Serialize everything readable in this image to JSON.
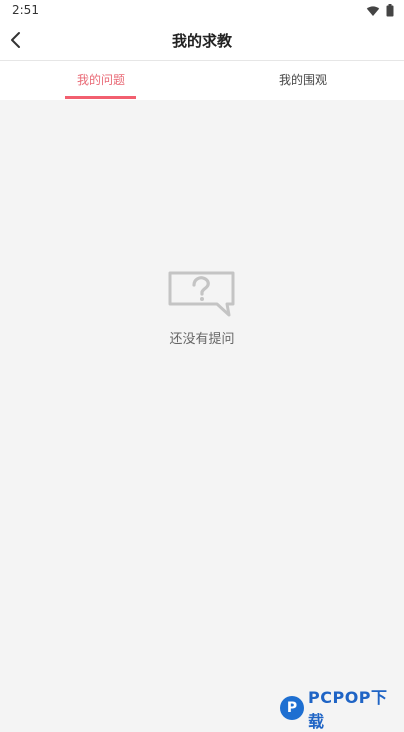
{
  "status": {
    "time": "2:51",
    "icons": [
      "wifi-icon",
      "battery-icon"
    ]
  },
  "header": {
    "title": "我的求教",
    "back_icon": "chevron-left-icon"
  },
  "tabs": [
    {
      "label": "我的问题",
      "active": true
    },
    {
      "label": "我的围观",
      "active": false
    }
  ],
  "empty_state": {
    "icon": "question-bubble-icon",
    "message": "还没有提问"
  },
  "watermark": {
    "icon": "pcpop-logo-icon",
    "text": "PCPOP下载"
  },
  "colors": {
    "accent": "#f25f6f",
    "background": "#f4f4f4",
    "surface": "#ffffff",
    "brand": "#1f64c5"
  }
}
